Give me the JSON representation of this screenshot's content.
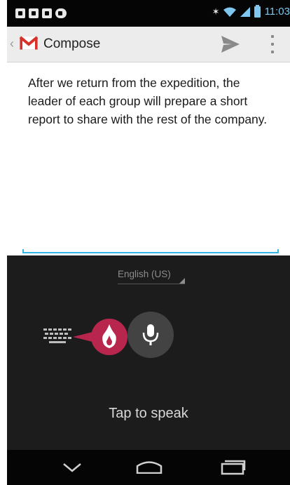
{
  "status_bar": {
    "time": "11:03",
    "notification_icons": [
      "app-notification-icon",
      "app-notification-icon",
      "app-notification-icon",
      "voicemail-icon"
    ],
    "system_icons": [
      "bluetooth-icon",
      "wifi-icon",
      "signal-icon",
      "battery-icon"
    ]
  },
  "action_bar": {
    "title": "Compose",
    "app_icon": "gmail-logo",
    "actions": [
      "send-icon",
      "overflow-menu-icon"
    ]
  },
  "compose": {
    "body_text": "After we return from the expedition, the leader of each group will prepare a short report to share with the rest of the company."
  },
  "voice_input": {
    "language": "English (US)",
    "hint": "Tap to speak",
    "icons": [
      "keyboard-icon",
      "ime-switch-icon",
      "microphone-icon"
    ]
  },
  "navigation": {
    "buttons": [
      "back-icon",
      "home-icon",
      "recents-icon"
    ]
  },
  "colors": {
    "accent_blue": "#33b5e5",
    "ime_red": "#b8254d",
    "panel_bg": "#1c1c1c",
    "mic_bg": "#434343"
  }
}
